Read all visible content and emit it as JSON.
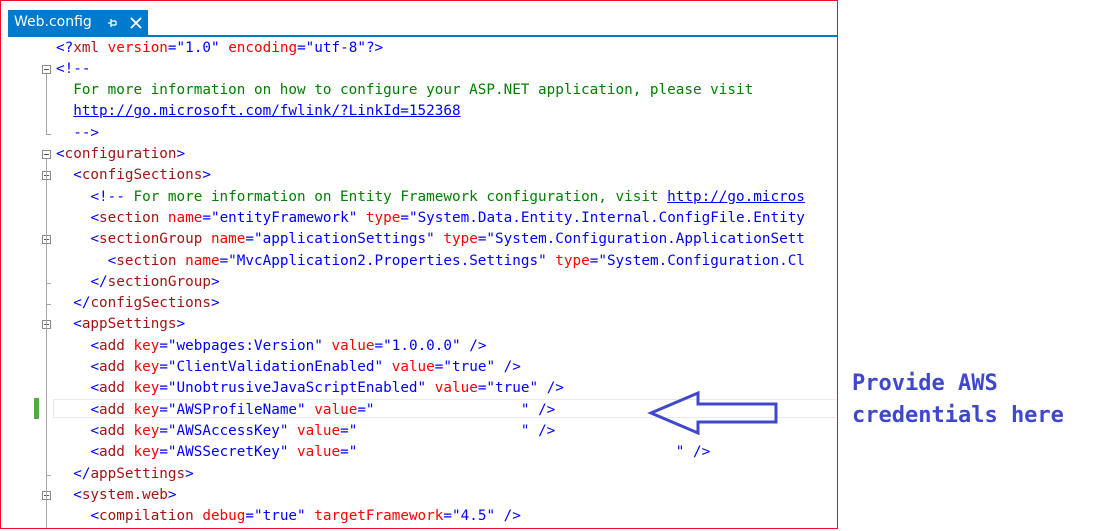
{
  "tab": {
    "title": "Web.config",
    "pin_icon": "pin-icon",
    "close_icon": "close-icon"
  },
  "colors": {
    "accent": "#007acc",
    "frame_border": "#e81123",
    "xml_bracket": "#0000ff",
    "xml_element": "#a31515",
    "xml_attribute": "#ff0000",
    "xml_value": "#0000ff",
    "xml_comment": "#008000",
    "annotation": "#3f48cc",
    "changed_line_marker": "#57a64a"
  },
  "lines": [
    {
      "tokens": [
        [
          "b",
          "<?"
        ],
        [
          "m",
          "xml"
        ],
        [
          "k",
          " "
        ],
        [
          "a",
          "version"
        ],
        [
          "b",
          "=\""
        ],
        [
          "v",
          "1.0"
        ],
        [
          "b",
          "\""
        ],
        [
          "k",
          " "
        ],
        [
          "a",
          "encoding"
        ],
        [
          "b",
          "=\""
        ],
        [
          "v",
          "utf-8"
        ],
        [
          "b",
          "\""
        ],
        [
          "b",
          "?>"
        ]
      ]
    },
    {
      "tokens": [
        [
          "b",
          "<!--"
        ]
      ]
    },
    {
      "tokens": [
        [
          "c",
          "  For more information on how to configure your ASP.NET application, please visit"
        ]
      ]
    },
    {
      "tokens": [
        [
          "c",
          "  "
        ],
        [
          "u",
          "http://go.microsoft.com/fwlink/?LinkId=152368"
        ]
      ]
    },
    {
      "tokens": [
        [
          "b",
          "  -->"
        ]
      ]
    },
    {
      "tokens": [
        [
          "b",
          "<"
        ],
        [
          "m",
          "configuration"
        ],
        [
          "b",
          ">"
        ]
      ]
    },
    {
      "tokens": [
        [
          "k",
          "  "
        ],
        [
          "b",
          "<"
        ],
        [
          "m",
          "configSections"
        ],
        [
          "b",
          ">"
        ]
      ]
    },
    {
      "tokens": [
        [
          "k",
          "    "
        ],
        [
          "b",
          "<!--"
        ],
        [
          "c",
          " For more information on Entity Framework configuration, visit "
        ],
        [
          "u",
          "http://go.micros"
        ]
      ]
    },
    {
      "tokens": [
        [
          "k",
          "    "
        ],
        [
          "b",
          "<"
        ],
        [
          "m",
          "section"
        ],
        [
          "k",
          " "
        ],
        [
          "a",
          "name"
        ],
        [
          "b",
          "=\""
        ],
        [
          "v",
          "entityFramework"
        ],
        [
          "b",
          "\""
        ],
        [
          "k",
          " "
        ],
        [
          "a",
          "type"
        ],
        [
          "b",
          "=\""
        ],
        [
          "v",
          "System.Data.Entity.Internal.ConfigFile.Entity"
        ]
      ]
    },
    {
      "tokens": [
        [
          "k",
          "    "
        ],
        [
          "b",
          "<"
        ],
        [
          "m",
          "sectionGroup"
        ],
        [
          "k",
          " "
        ],
        [
          "a",
          "name"
        ],
        [
          "b",
          "=\""
        ],
        [
          "v",
          "applicationSettings"
        ],
        [
          "b",
          "\""
        ],
        [
          "k",
          " "
        ],
        [
          "a",
          "type"
        ],
        [
          "b",
          "=\""
        ],
        [
          "v",
          "System.Configuration.ApplicationSett"
        ]
      ]
    },
    {
      "tokens": [
        [
          "k",
          "      "
        ],
        [
          "b",
          "<"
        ],
        [
          "m",
          "section"
        ],
        [
          "k",
          " "
        ],
        [
          "a",
          "name"
        ],
        [
          "b",
          "=\""
        ],
        [
          "v",
          "MvcApplication2.Properties.Settings"
        ],
        [
          "b",
          "\""
        ],
        [
          "k",
          " "
        ],
        [
          "a",
          "type"
        ],
        [
          "b",
          "=\""
        ],
        [
          "v",
          "System.Configuration.Cl"
        ]
      ]
    },
    {
      "tokens": [
        [
          "k",
          "    "
        ],
        [
          "b",
          "</"
        ],
        [
          "m",
          "sectionGroup"
        ],
        [
          "b",
          ">"
        ]
      ]
    },
    {
      "tokens": [
        [
          "k",
          "  "
        ],
        [
          "b",
          "</"
        ],
        [
          "m",
          "configSections"
        ],
        [
          "b",
          ">"
        ]
      ]
    },
    {
      "tokens": [
        [
          "k",
          "  "
        ],
        [
          "b",
          "<"
        ],
        [
          "m",
          "appSettings"
        ],
        [
          "b",
          ">"
        ]
      ]
    },
    {
      "tokens": [
        [
          "k",
          "    "
        ],
        [
          "b",
          "<"
        ],
        [
          "m",
          "add"
        ],
        [
          "k",
          " "
        ],
        [
          "a",
          "key"
        ],
        [
          "b",
          "=\""
        ],
        [
          "v",
          "webpages:Version"
        ],
        [
          "b",
          "\""
        ],
        [
          "k",
          " "
        ],
        [
          "a",
          "value"
        ],
        [
          "b",
          "=\""
        ],
        [
          "v",
          "1.0.0.0"
        ],
        [
          "b",
          "\""
        ],
        [
          "k",
          " "
        ],
        [
          "b",
          "/>"
        ]
      ]
    },
    {
      "tokens": [
        [
          "k",
          "    "
        ],
        [
          "b",
          "<"
        ],
        [
          "m",
          "add"
        ],
        [
          "k",
          " "
        ],
        [
          "a",
          "key"
        ],
        [
          "b",
          "=\""
        ],
        [
          "v",
          "ClientValidationEnabled"
        ],
        [
          "b",
          "\""
        ],
        [
          "k",
          " "
        ],
        [
          "a",
          "value"
        ],
        [
          "b",
          "=\""
        ],
        [
          "v",
          "true"
        ],
        [
          "b",
          "\""
        ],
        [
          "k",
          " "
        ],
        [
          "b",
          "/>"
        ]
      ]
    },
    {
      "tokens": [
        [
          "k",
          "    "
        ],
        [
          "b",
          "<"
        ],
        [
          "m",
          "add"
        ],
        [
          "k",
          " "
        ],
        [
          "a",
          "key"
        ],
        [
          "b",
          "=\""
        ],
        [
          "v",
          "UnobtrusiveJavaScriptEnabled"
        ],
        [
          "b",
          "\""
        ],
        [
          "k",
          " "
        ],
        [
          "a",
          "value"
        ],
        [
          "b",
          "=\""
        ],
        [
          "v",
          "true"
        ],
        [
          "b",
          "\""
        ],
        [
          "k",
          " "
        ],
        [
          "b",
          "/>"
        ]
      ]
    },
    {
      "tokens": [
        [
          "k",
          "    "
        ],
        [
          "b",
          "<"
        ],
        [
          "m",
          "add"
        ],
        [
          "k",
          " "
        ],
        [
          "a",
          "key"
        ],
        [
          "b",
          "=\""
        ],
        [
          "v",
          "AWSProfileName"
        ],
        [
          "b",
          "\""
        ],
        [
          "k",
          " "
        ],
        [
          "a",
          "value"
        ],
        [
          "b",
          "=\""
        ],
        [
          "v",
          "                 "
        ],
        [
          "b",
          "\""
        ],
        [
          "k",
          " "
        ],
        [
          "b",
          "/>"
        ]
      ]
    },
    {
      "tokens": [
        [
          "k",
          "    "
        ],
        [
          "b",
          "<"
        ],
        [
          "m",
          "add"
        ],
        [
          "k",
          " "
        ],
        [
          "a",
          "key"
        ],
        [
          "b",
          "=\""
        ],
        [
          "v",
          "AWSAccessKey"
        ],
        [
          "b",
          "\""
        ],
        [
          "k",
          " "
        ],
        [
          "a",
          "value"
        ],
        [
          "b",
          "=\""
        ],
        [
          "v",
          "                   "
        ],
        [
          "b",
          "\""
        ],
        [
          "k",
          " "
        ],
        [
          "b",
          "/>"
        ]
      ]
    },
    {
      "tokens": [
        [
          "k",
          "    "
        ],
        [
          "b",
          "<"
        ],
        [
          "m",
          "add"
        ],
        [
          "k",
          " "
        ],
        [
          "a",
          "key"
        ],
        [
          "b",
          "=\""
        ],
        [
          "v",
          "AWSSecretKey"
        ],
        [
          "b",
          "\""
        ],
        [
          "k",
          " "
        ],
        [
          "a",
          "value"
        ],
        [
          "b",
          "=\""
        ],
        [
          "v",
          "                                     "
        ],
        [
          "b",
          "\""
        ],
        [
          "k",
          " "
        ],
        [
          "b",
          "/>"
        ]
      ]
    },
    {
      "tokens": [
        [
          "k",
          "  "
        ],
        [
          "b",
          "</"
        ],
        [
          "m",
          "appSettings"
        ],
        [
          "b",
          ">"
        ]
      ]
    },
    {
      "tokens": [
        [
          "k",
          "  "
        ],
        [
          "b",
          "<"
        ],
        [
          "m",
          "system.web"
        ],
        [
          "b",
          ">"
        ]
      ]
    },
    {
      "tokens": [
        [
          "k",
          "    "
        ],
        [
          "b",
          "<"
        ],
        [
          "m",
          "compilation"
        ],
        [
          "k",
          " "
        ],
        [
          "a",
          "debug"
        ],
        [
          "b",
          "=\""
        ],
        [
          "v",
          "true"
        ],
        [
          "b",
          "\""
        ],
        [
          "k",
          " "
        ],
        [
          "a",
          "targetFramework"
        ],
        [
          "b",
          "=\""
        ],
        [
          "v",
          "4.5"
        ],
        [
          "b",
          "\""
        ],
        [
          "k",
          " "
        ],
        [
          "b",
          "/>"
        ]
      ]
    }
  ],
  "annotation": {
    "line1": "Provide AWS",
    "line2": "credentials here",
    "arrow_icon": "left-arrow-icon"
  }
}
